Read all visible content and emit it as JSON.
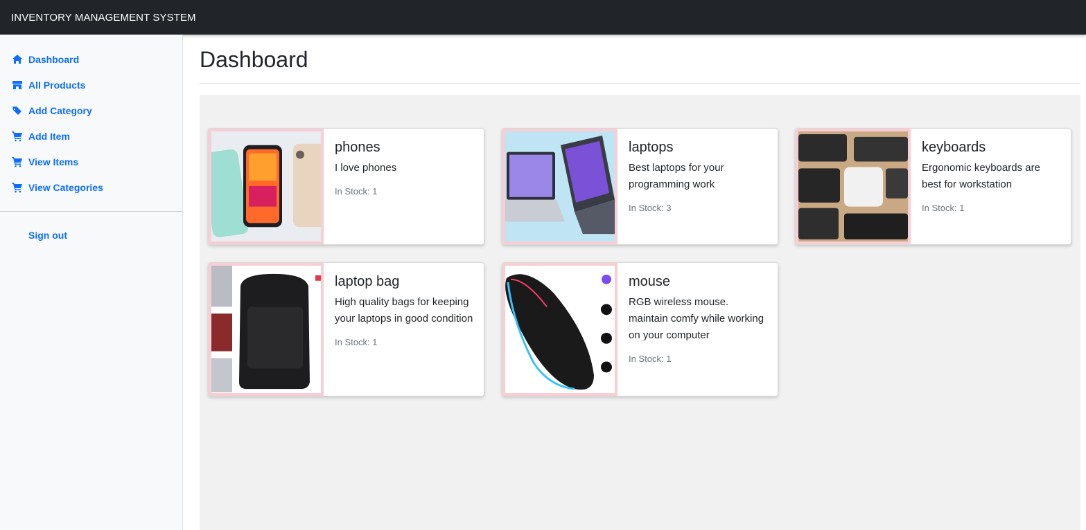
{
  "app": {
    "title": "INVENTORY MANAGEMENT SYSTEM"
  },
  "sidebar": {
    "items": [
      {
        "label": "Dashboard",
        "icon": "home-icon"
      },
      {
        "label": "All Products",
        "icon": "store-icon"
      },
      {
        "label": "Add Category",
        "icon": "tags-icon"
      },
      {
        "label": "Add Item",
        "icon": "cart-icon"
      },
      {
        "label": "View Items",
        "icon": "cart-icon"
      },
      {
        "label": "View Categories",
        "icon": "cart-icon"
      }
    ],
    "signout": "Sign out"
  },
  "main": {
    "title": "Dashboard",
    "cards": [
      {
        "name": "phones",
        "description": "I love phones",
        "stock": "In Stock: 1",
        "image": "phones-image"
      },
      {
        "name": "laptops",
        "description": "Best laptops for your programming work",
        "stock": "In Stock: 3",
        "image": "laptops-image"
      },
      {
        "name": "keyboards",
        "description": "Ergonomic keyboards are best for workstation",
        "stock": "In Stock: 1",
        "image": "keyboards-image"
      },
      {
        "name": "laptop bag",
        "description": "High quality bags for keeping your laptops in good condition",
        "stock": "In Stock: 1",
        "image": "laptop-bag-image"
      },
      {
        "name": "mouse",
        "description": "RGB wireless mouse. maintain comfy while working on your computer",
        "stock": "In Stock: 1",
        "image": "mouse-image"
      }
    ]
  },
  "colors": {
    "accent": "#0d6efd",
    "topbar": "#212529",
    "card_image_border": "#f8cdd3",
    "content_bg": "#f1f1f1"
  }
}
